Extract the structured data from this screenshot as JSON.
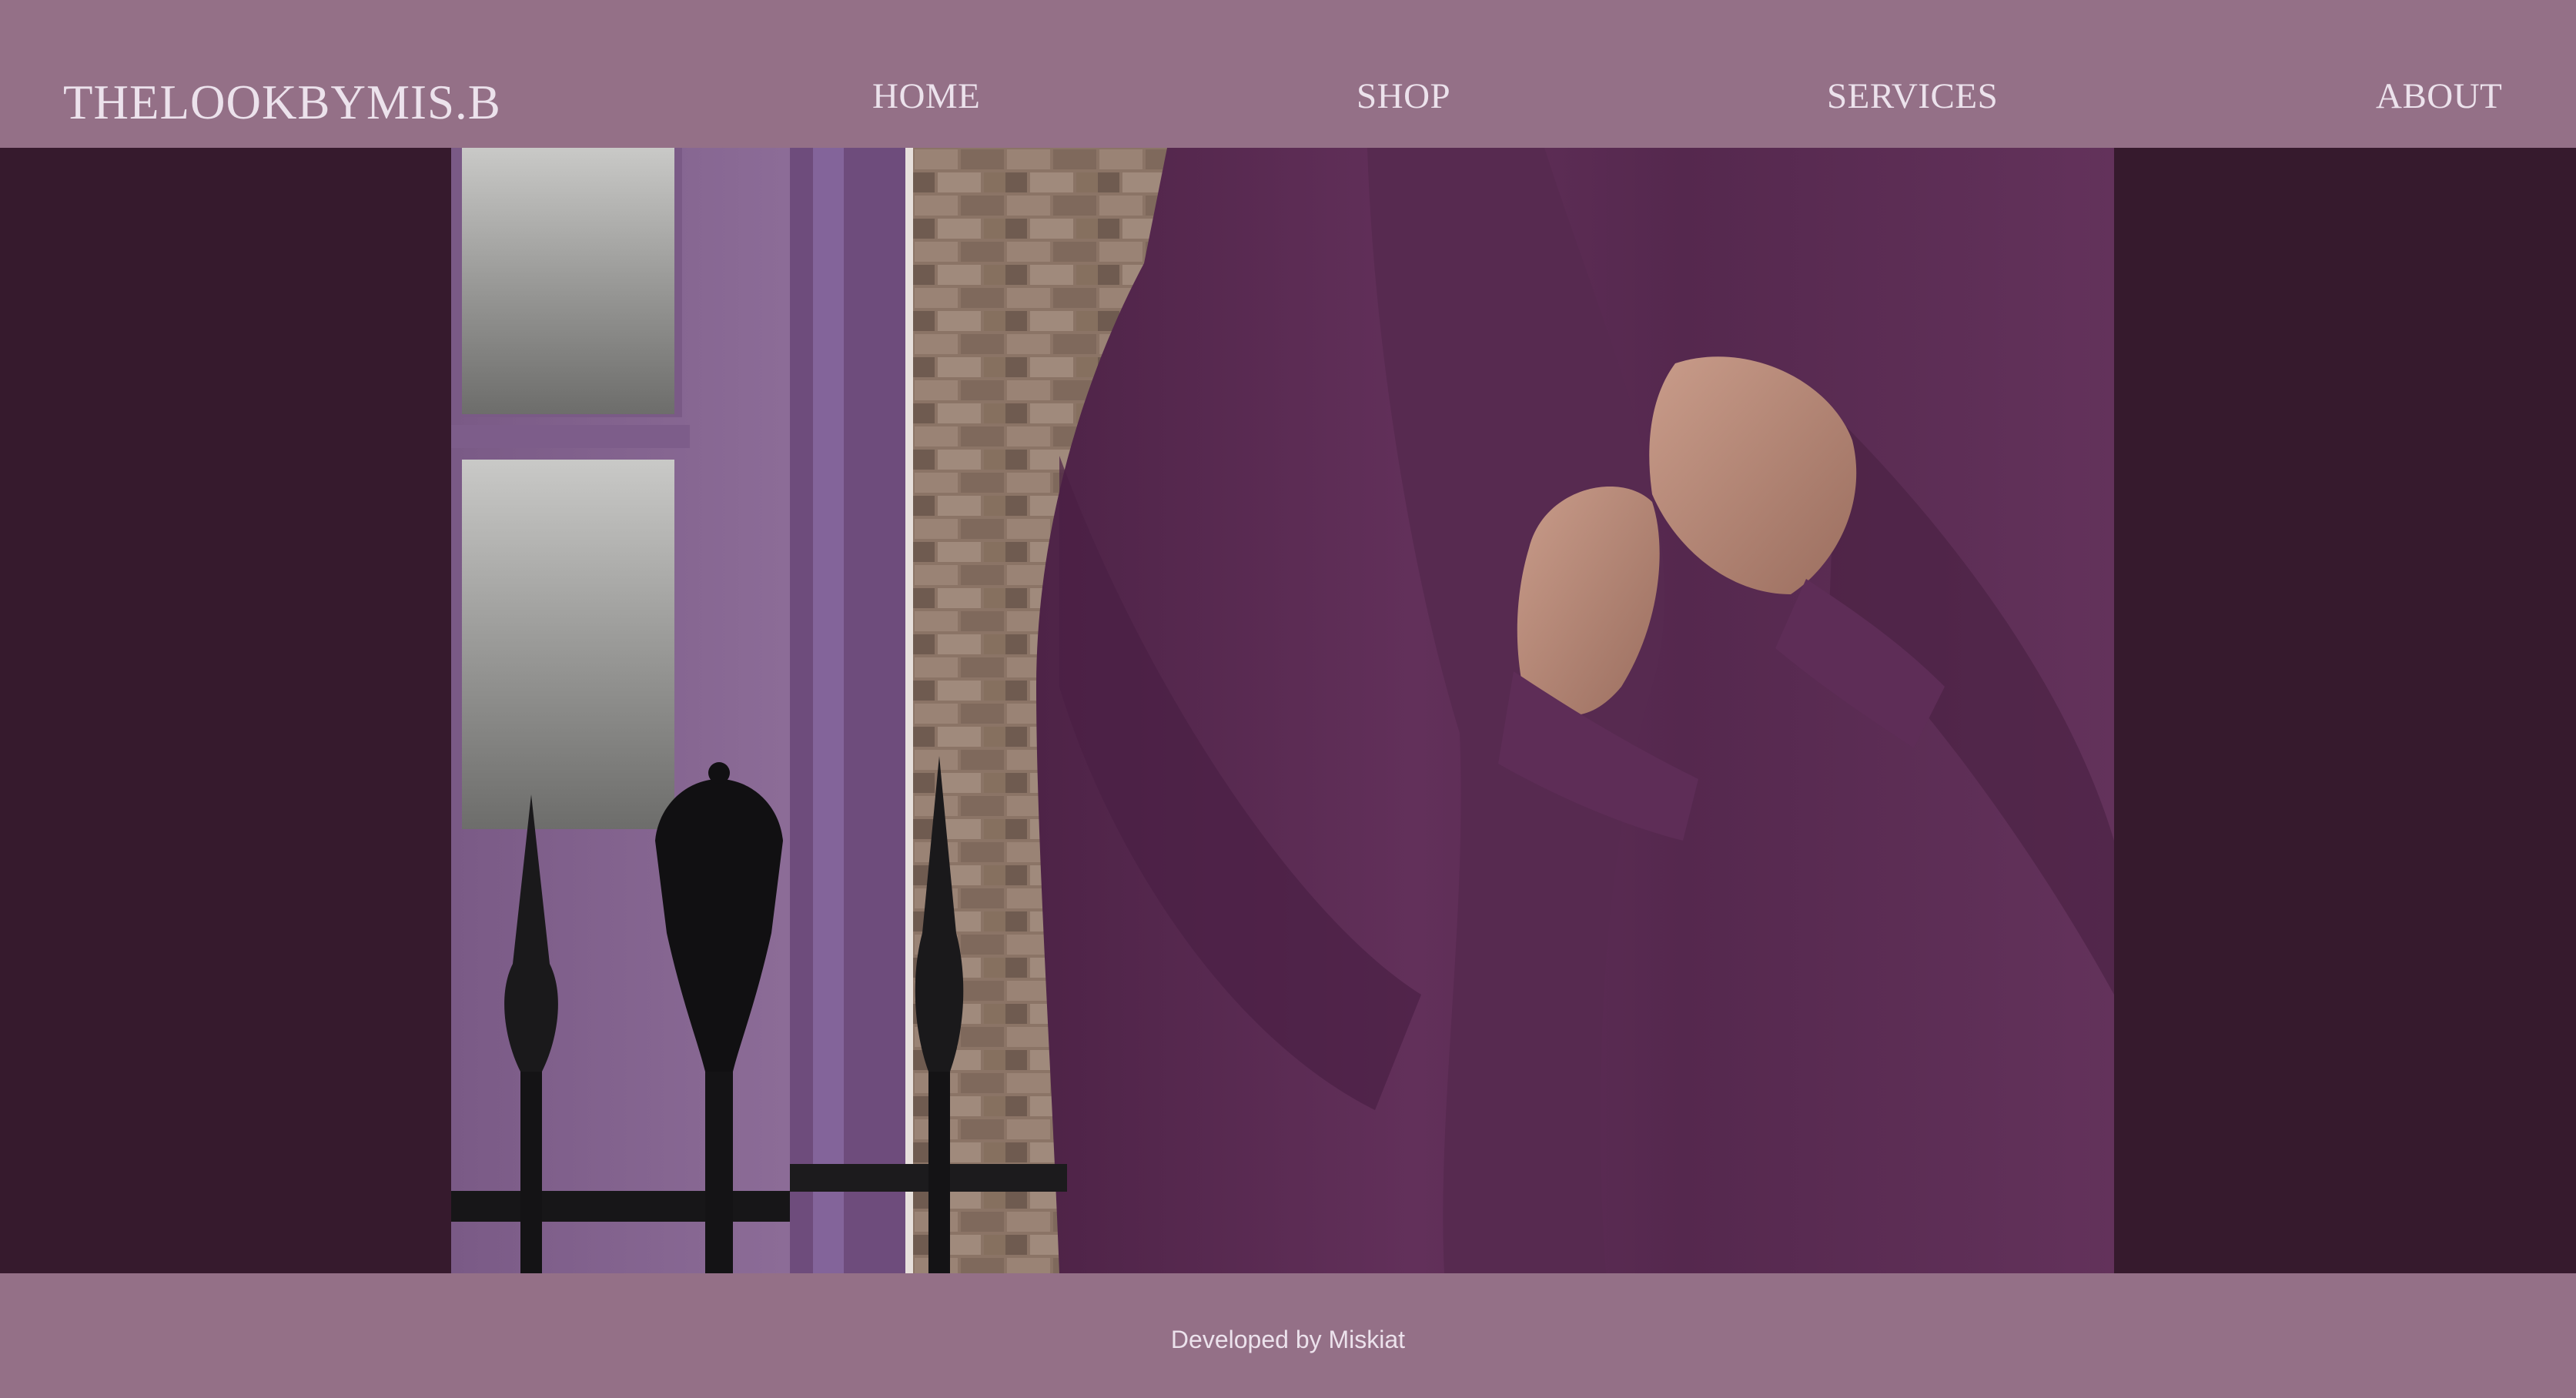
{
  "header": {
    "brand": "THELOOKBYMIS.B",
    "nav": [
      {
        "label": "HOME"
      },
      {
        "label": "SHOP"
      },
      {
        "label": "SERVICES"
      },
      {
        "label": "ABOUT"
      }
    ]
  },
  "footer": {
    "credit": "Developed by Miskiat"
  },
  "colors": {
    "header_bg": "#947087",
    "page_bg": "#361a2d",
    "text": "#ece2ec",
    "garment": "#5a2b52"
  }
}
